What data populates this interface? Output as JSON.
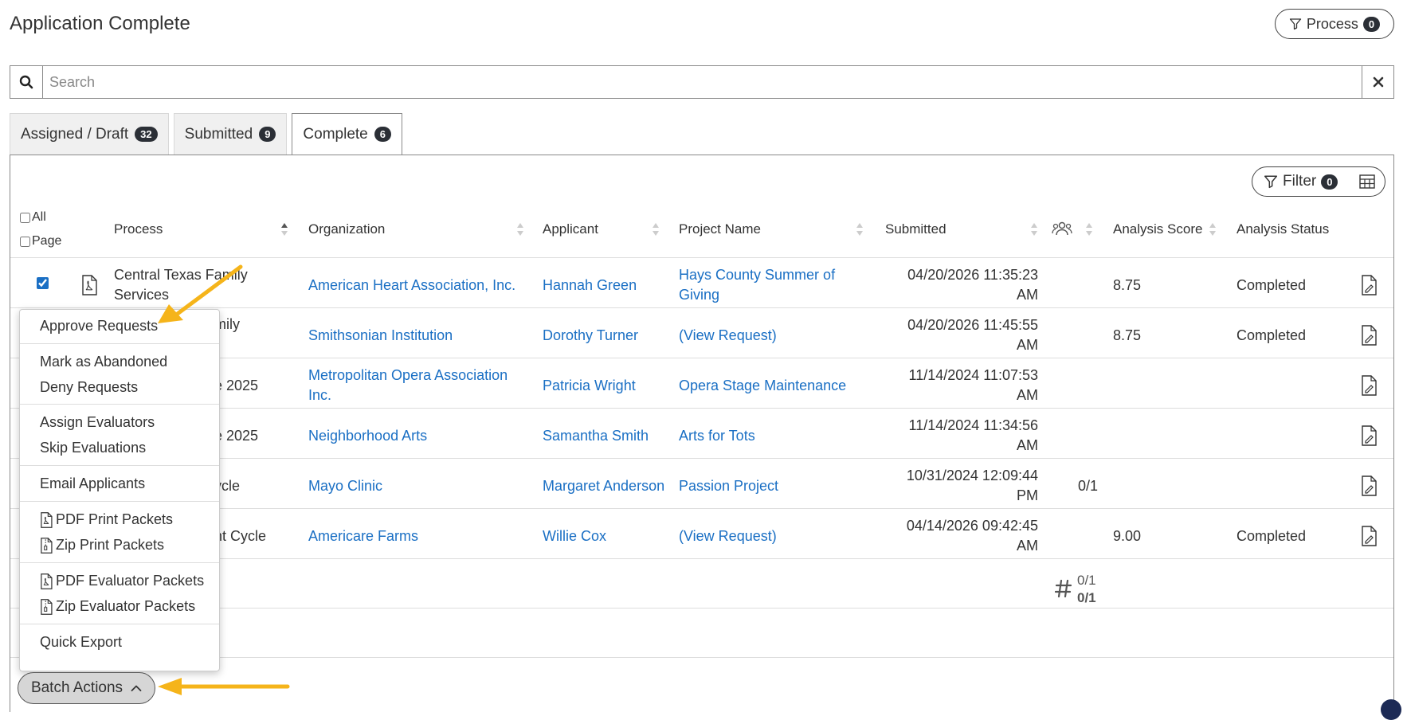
{
  "page": {
    "title": "Application Complete"
  },
  "process_button": {
    "label": "Process",
    "count": "0",
    "icon": "funnel-icon"
  },
  "search": {
    "placeholder": "Search",
    "icon": "search-icon",
    "clear_icon": "close-icon"
  },
  "tabs": [
    {
      "label": "Assigned / Draft",
      "count": "32"
    },
    {
      "label": "Submitted",
      "count": "9"
    },
    {
      "label": "Complete",
      "count": "6",
      "active": true
    }
  ],
  "filter_button": {
    "label": "Filter",
    "count": "0"
  },
  "table": {
    "select_all": "All",
    "select_page": "Page",
    "columns": {
      "process": "Process",
      "organization": "Organization",
      "applicant": "Applicant",
      "project_name": "Project Name",
      "submitted": "Submitted",
      "evaluators_icon": "people-icon",
      "analysis_score": "Analysis Score",
      "analysis_status": "Analysis Status"
    },
    "rows": [
      {
        "checked": true,
        "process_l1": "Central Texas Family",
        "process_l2": "Services",
        "organization_l1": "American Heart Association, Inc.",
        "organization_l2": "",
        "applicant": "Hannah Green",
        "project_l1": "Hays County Summer of",
        "project_l2": "Giving",
        "submitted_l1": "04/20/2026 11:35:23",
        "submitted_l2": "AM",
        "evaluators": "",
        "score": "8.75",
        "status": "Completed"
      },
      {
        "checked": false,
        "process_l1": "mily",
        "process_l2": "",
        "organization_l1": "Smithsonian Institution",
        "organization_l2": "",
        "applicant": "Dorothy Turner",
        "project_l1": "(View Request)",
        "project_l2": "",
        "submitted_l1": "04/20/2026 11:45:55",
        "submitted_l2": "AM",
        "evaluators": "",
        "score": "8.75",
        "status": "Completed"
      },
      {
        "checked": false,
        "process_l1": "e 2025",
        "process_l2": "",
        "organization_l1": "Metropolitan Opera Association",
        "organization_l2": "Inc.",
        "applicant": "Patricia Wright",
        "project_l1": "Opera Stage Maintenance",
        "project_l2": "",
        "submitted_l1": "11/14/2024 11:07:53",
        "submitted_l2": "AM",
        "evaluators": "",
        "score": "",
        "status": ""
      },
      {
        "checked": false,
        "process_l1": "e 2025",
        "process_l2": "",
        "organization_l1": "Neighborhood Arts",
        "organization_l2": "",
        "applicant": "Samantha Smith",
        "project_l1": "Arts for Tots",
        "project_l2": "",
        "submitted_l1": "11/14/2024 11:34:56",
        "submitted_l2": "AM",
        "evaluators": "",
        "score": "",
        "status": ""
      },
      {
        "checked": false,
        "process_l1": "ycle",
        "process_l2": "",
        "organization_l1": "Mayo Clinic",
        "organization_l2": "",
        "applicant": "Margaret Anderson",
        "project_l1": "Passion Project",
        "project_l2": "",
        "submitted_l1": "10/31/2024 12:09:44",
        "submitted_l2": "PM",
        "evaluators": "0/1",
        "score": "",
        "status": ""
      },
      {
        "checked": false,
        "process_l1": "nt Cycle",
        "process_l2": "",
        "organization_l1": "Americare Farms",
        "organization_l2": "",
        "applicant": "Willie Cox",
        "project_l1": "(View Request)",
        "project_l2": "",
        "submitted_l1": "04/14/2026 09:42:45",
        "submitted_l2": "AM",
        "evaluators": "",
        "score": "9.00",
        "status": "Completed"
      }
    ],
    "totals": {
      "line1": "0/1",
      "line2": "0/1",
      "icon": "hash-icon"
    }
  },
  "batch_menu": {
    "items": [
      {
        "label": "Approve Requests"
      },
      {
        "label": "Mark as Abandoned"
      },
      {
        "label": "Deny Requests"
      },
      {
        "label": "Assign Evaluators"
      },
      {
        "label": "Skip Evaluations"
      },
      {
        "label": "Email Applicants"
      },
      {
        "label": "PDF Print Packets",
        "icon": "pdf-file-icon"
      },
      {
        "label": "Zip Print Packets",
        "icon": "zip-file-icon"
      },
      {
        "label": "PDF Evaluator Packets",
        "icon": "pdf-file-icon"
      },
      {
        "label": "Zip Evaluator Packets",
        "icon": "zip-file-icon"
      },
      {
        "label": "Quick Export"
      }
    ]
  },
  "batch_button": {
    "label": "Batch Actions",
    "icon": "chevron-up-icon"
  },
  "colors": {
    "link": "#1a6fc4",
    "badge": "#2b2f36",
    "annotation_arrow": "#f5b41a"
  }
}
